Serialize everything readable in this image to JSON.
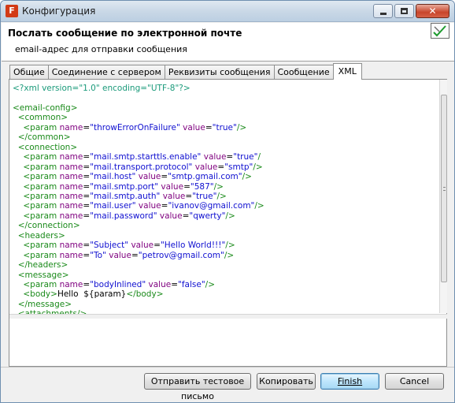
{
  "window": {
    "title": "Конфигурация",
    "app_icon_letter": "F"
  },
  "header": {
    "title": "Послать сообщение по электронной почте",
    "description": "email-адрес для отправки сообщения"
  },
  "tabs": [
    {
      "label": "Общие",
      "active": false
    },
    {
      "label": "Соединение с сервером",
      "active": false
    },
    {
      "label": "Реквизиты сообщения",
      "active": false
    },
    {
      "label": "Сообщение",
      "active": false
    },
    {
      "label": "XML",
      "active": true
    }
  ],
  "xml_lines": [
    "<?xml version=\"1.0\" encoding=\"UTF-8\"?>",
    "",
    "<email-config>",
    "  <common>",
    "    <param name=\"throwErrorOnFailure\" value=\"true\"/>",
    "  </common>",
    "  <connection>",
    "    <param name=\"mail.smtp.starttls.enable\" value=\"true\"/>",
    "    <param name=\"mail.transport.protocol\" value=\"smtp\"/>",
    "    <param name=\"mail.host\" value=\"smtp.gmail.com\"/>",
    "    <param name=\"mail.smtp.port\" value=\"587\"/>",
    "    <param name=\"mail.smtp.auth\" value=\"true\"/>",
    "    <param name=\"mail.user\" value=\"ivanov@gmail.com\"/>",
    "    <param name=\"mail.password\" value=\"qwerty\"/>",
    "  </connection>",
    "  <headers>",
    "    <param name=\"Subject\" value=\"Hello World!!!\"/>",
    "    <param name=\"To\" value=\"petrov@gmail.com\"/>",
    "  </headers>",
    "  <message>",
    "    <param name=\"bodyInlined\" value=\"false\"/>",
    "    <body>Hello  ${param}</body>",
    "  </message>",
    "  <attachments/>"
  ],
  "caret_line": 7,
  "buttons": {
    "send_test": "Отправить тестовое письмо",
    "copy": "Копировать",
    "finish": "Finish",
    "cancel": "Cancel"
  },
  "colors": {
    "xml_tag": "#1a8a1a",
    "xml_attr_name": "#7f007f",
    "xml_attr_value": "#1010d0",
    "xml_decl": "#1a9a7a"
  }
}
